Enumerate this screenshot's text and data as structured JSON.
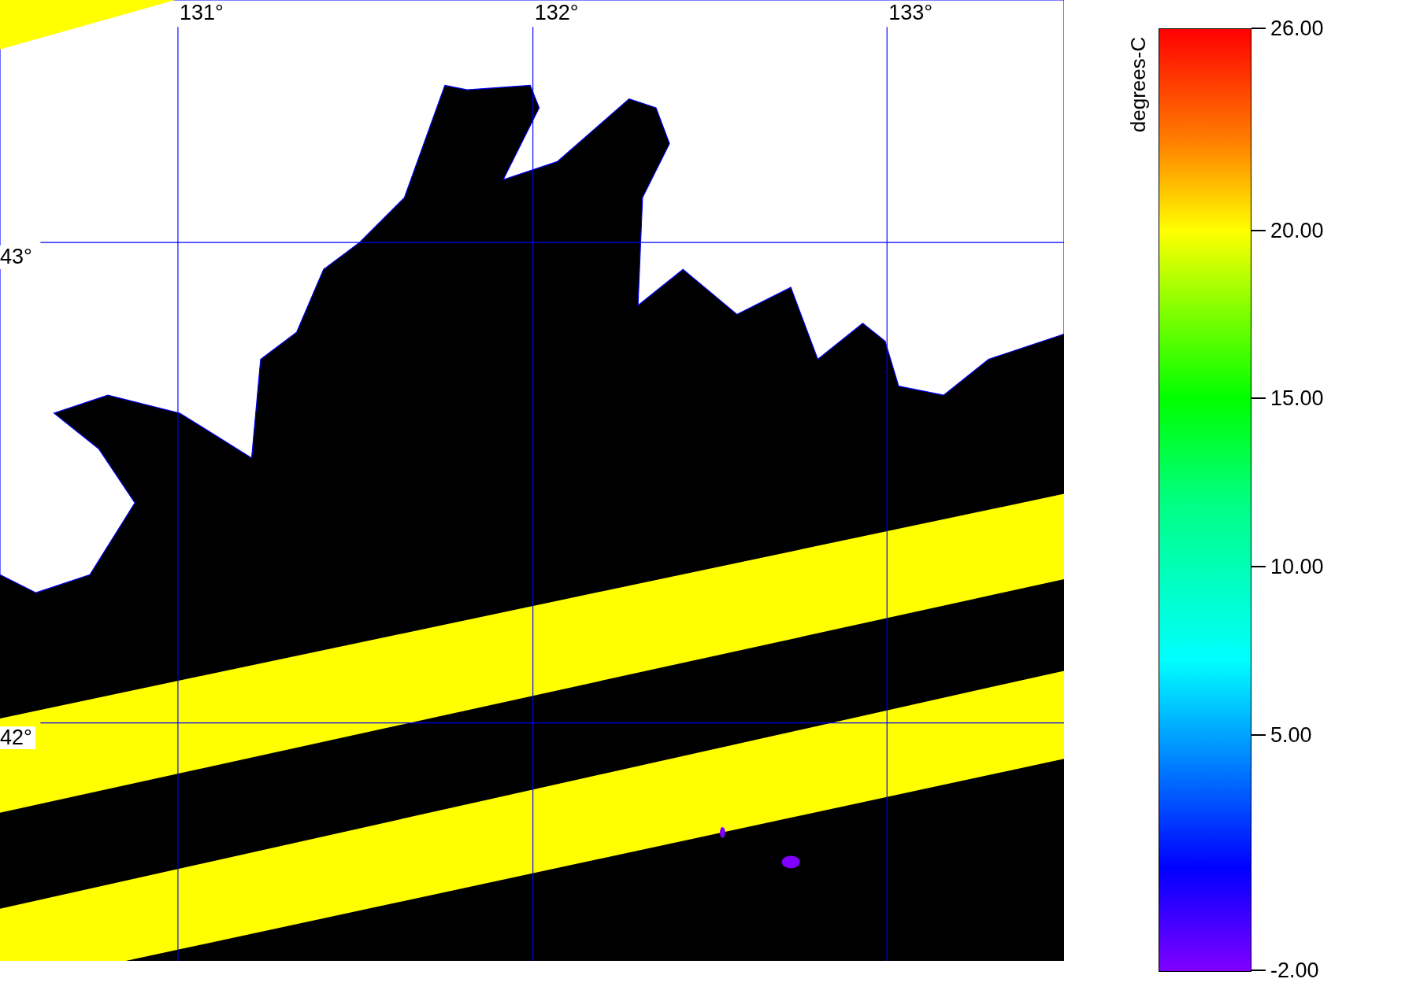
{
  "map": {
    "longitude_labels": [
      "131°",
      "132°",
      "133°"
    ],
    "latitude_labels": [
      "43°",
      "42°"
    ]
  },
  "colorbar": {
    "title": "degrees-C",
    "ticks": [
      "26.00",
      "20.00",
      "15.00",
      "10.00",
      "5.00",
      "-2.00"
    ]
  }
}
